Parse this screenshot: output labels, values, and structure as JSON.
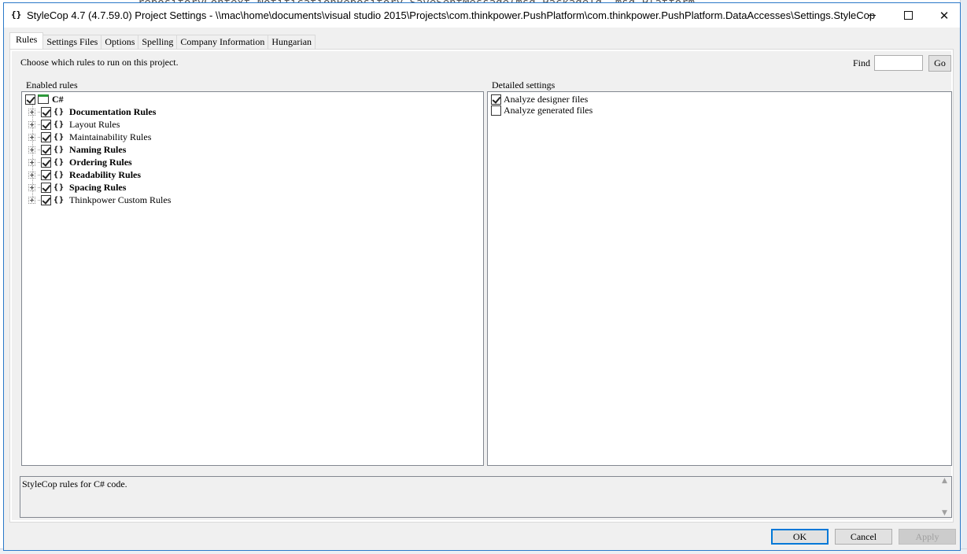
{
  "background": {
    "code_line": "repositoryContext.NotificationRepository.SaveSentMessage(msg.PackageId, msg.Platform"
  },
  "window": {
    "icon": "{}",
    "title": "StyleCop 4.7 (4.7.59.0) Project Settings - \\\\mac\\home\\documents\\visual studio 2015\\Projects\\com.thinkpower.PushPlatform\\com.thinkpower.PushPlatform.DataAccesses\\Settings.StyleCop",
    "controls": {
      "close": "✕"
    }
  },
  "tabs": [
    {
      "label": "Rules",
      "active": true
    },
    {
      "label": "Settings Files",
      "active": false
    },
    {
      "label": "Options",
      "active": false
    },
    {
      "label": "Spelling",
      "active": false
    },
    {
      "label": "Company Information",
      "active": false
    },
    {
      "label": "Hungarian",
      "active": false
    }
  ],
  "rules_tab": {
    "instruction": "Choose which rules to run on this project.",
    "find": {
      "label": "Find",
      "value": "",
      "go_label": "Go"
    },
    "enabled_rules_label": "Enabled rules",
    "detailed_settings_label": "Detailed settings",
    "tree": {
      "root": {
        "label": "C#",
        "checked": true,
        "bold": true
      },
      "rule_icon": "{}",
      "children": [
        {
          "label": "Documentation Rules",
          "checked": true,
          "bold": true
        },
        {
          "label": "Layout Rules",
          "checked": true,
          "bold": false
        },
        {
          "label": "Maintainability Rules",
          "checked": true,
          "bold": false
        },
        {
          "label": "Naming Rules",
          "checked": true,
          "bold": true
        },
        {
          "label": "Ordering Rules",
          "checked": true,
          "bold": true
        },
        {
          "label": "Readability Rules",
          "checked": true,
          "bold": true
        },
        {
          "label": "Spacing Rules",
          "checked": true,
          "bold": true
        },
        {
          "label": "Thinkpower Custom Rules",
          "checked": true,
          "bold": false
        }
      ]
    },
    "detailed_settings": [
      {
        "label": "Analyze designer files",
        "checked": true
      },
      {
        "label": "Analyze generated files",
        "checked": false
      }
    ],
    "description": "StyleCop rules for C# code."
  },
  "buttons": {
    "ok": "OK",
    "cancel": "Cancel",
    "apply": "Apply"
  },
  "colors": {
    "accent": "#0078d7",
    "window_border": "#2a79c9",
    "dialog_bg": "#f0f0f0"
  }
}
